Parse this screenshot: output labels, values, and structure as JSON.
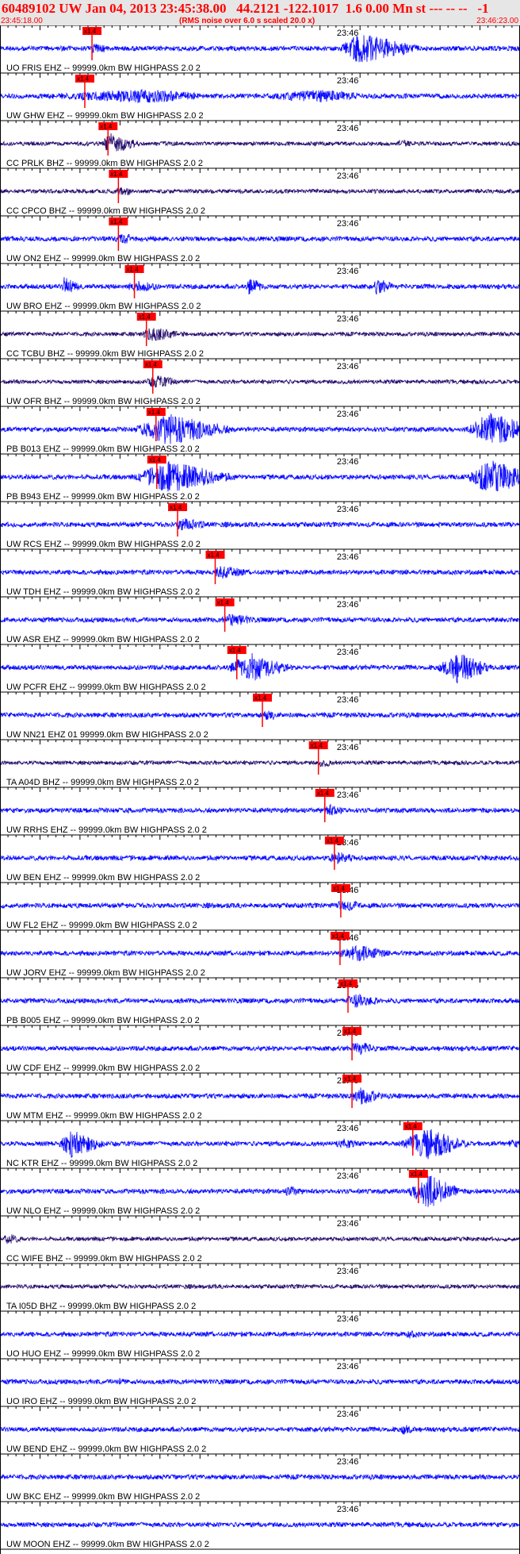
{
  "header": {
    "title": "60489102 UW Jan 04, 2013 23:45:38.00   44.2121 -122.1017  1.6 0.00 Mn st --- -- --   -1",
    "start_time": "23:45:18.00",
    "note": "(RMS noise over 6.0 s scaled 20.0 x)",
    "end_time": "23:46:23.00"
  },
  "colors": {
    "trace_blue": "#0000ff",
    "trace_dark": "#1a0066",
    "pick_red": "#ff0000",
    "header_bg": "#e6e6e6",
    "header_text": "#ff0000"
  },
  "chart_data": {
    "type": "line",
    "title": "60489102 UW Jan 04, 2013 23:45:38.00   44.2121 -122.1017  1.6 0.00 Mn st --- -- --   -1",
    "x_range": [
      "23:45:18.00",
      "23:46:23.00"
    ],
    "minute_mark": "23:46",
    "pick_label": "x1.4",
    "grid": false,
    "traces": [
      {
        "label": "UO FRIS EHZ -- 99999.0km BW  HIGHPASS  2.0  2",
        "color": "blue",
        "pick_s": 11.5,
        "bursts": [
          [
            45,
            3,
            9,
            20
          ],
          [
            7.5,
            1,
            4,
            4
          ]
        ]
      },
      {
        "label": "UW GHW EHZ -- 99999.0km BW  HIGHPASS  2.0  2",
        "color": "blue",
        "pick_s": 10.6,
        "bursts": [
          [
            19,
            20,
            10,
            9
          ],
          [
            40,
            12,
            9,
            8
          ]
        ]
      },
      {
        "label": "CC PRLK BHZ -- 99999.0km BW  HIGHPASS  2.0  2",
        "color": "dark",
        "pick_s": 13.5,
        "bursts": [
          [
            13.6,
            1,
            5,
            14
          ],
          [
            50,
            1,
            4,
            5
          ]
        ]
      },
      {
        "label": "CC CPCO BHZ -- 99999.0km BW  HIGHPASS  2.0  2",
        "color": "dark",
        "pick_s": 14.8,
        "bursts": [
          [
            15,
            2,
            3,
            5
          ]
        ]
      },
      {
        "label": "UW ON2 EHZ -- 99999.0km BW  HIGHPASS  2.0  2",
        "color": "blue",
        "pick_s": 14.8,
        "bursts": [
          [
            15,
            1,
            3,
            5
          ],
          [
            30,
            3,
            3,
            3
          ]
        ]
      },
      {
        "label": "UW BRO EHZ -- 99999.0km BW  HIGHPASS  2.0  2",
        "color": "blue",
        "pick_s": 16.8,
        "bursts": [
          [
            8,
            0.3,
            3,
            12
          ],
          [
            17,
            2,
            5,
            8
          ],
          [
            31,
            0.3,
            3,
            12
          ],
          [
            47,
            0.3,
            3,
            12
          ]
        ]
      },
      {
        "label": "CC TCBU BHZ -- 99999.0km BW  HIGHPASS  2.0  2",
        "color": "dark",
        "pick_s": 18.3,
        "bursts": [
          [
            19,
            2,
            6,
            9
          ]
        ]
      },
      {
        "label": "UW OFR BHZ -- 99999.0km BW  HIGHPASS  2.0  2",
        "color": "dark",
        "pick_s": 19.1,
        "bursts": [
          [
            19.5,
            2,
            4,
            9
          ]
        ]
      },
      {
        "label": "PB B013 EHZ -- 99999.0km BW  HIGHPASS  2.0  2",
        "color": "blue",
        "pick_s": 19.5,
        "bursts": [
          [
            21,
            5,
            10,
            20
          ],
          [
            61,
            3,
            8,
            22
          ]
        ]
      },
      {
        "label": "PB B943 EHZ -- 99999.0km BW  HIGHPASS  2.0  2",
        "color": "blue",
        "pick_s": 19.6,
        "bursts": [
          [
            21,
            5,
            10,
            20
          ],
          [
            61,
            3,
            8,
            22
          ]
        ]
      },
      {
        "label": "UW RCS EHZ -- 99999.0km BW  HIGHPASS  2.0  2",
        "color": "blue",
        "pick_s": 22.2,
        "bursts": [
          [
            22.8,
            1.5,
            5,
            9
          ]
        ]
      },
      {
        "label": "UW TDH EHZ -- 99999.0km BW  HIGHPASS  2.0  2",
        "color": "blue",
        "pick_s": 26.9,
        "bursts": [
          [
            27.6,
            1.5,
            5,
            9
          ]
        ]
      },
      {
        "label": "UW ASR EHZ -- 99999.0km BW  HIGHPASS  2.0  2",
        "color": "blue",
        "pick_s": 28.1,
        "bursts": [
          [
            28.7,
            1.5,
            5,
            9
          ]
        ]
      },
      {
        "label": "UW PCFR EHZ -- 99999.0km BW  HIGHPASS  2.0  2",
        "color": "blue",
        "pick_s": 29.6,
        "bursts": [
          [
            31.5,
            4,
            6,
            18
          ],
          [
            57.2,
            3,
            5,
            20
          ]
        ]
      },
      {
        "label": "UW NN21 EHZ 01 99999.0km BW  HIGHPASS  2.0  2",
        "color": "blue",
        "pick_s": 32.8,
        "bursts": []
      },
      {
        "label": "TA A04D BHZ -- 99999.0km BW  HIGHPASS  2.0  2",
        "color": "dark",
        "pick_s": 39.8,
        "bursts": []
      },
      {
        "label": "UW RRHS EHZ -- 99999.0km BW  HIGHPASS  2.0  2",
        "color": "blue",
        "pick_s": 40.6,
        "bursts": [
          [
            41,
            1,
            4,
            8
          ],
          [
            16,
            1,
            3,
            4
          ]
        ]
      },
      {
        "label": "UW BEN EHZ -- 99999.0km BW  HIGHPASS  2.0  2",
        "color": "blue",
        "pick_s": 41.8,
        "bursts": [
          [
            42,
            1.5,
            4,
            9
          ]
        ]
      },
      {
        "label": "UW FL2 EHZ -- 99999.0km BW  HIGHPASS  2.0  2",
        "color": "blue",
        "pick_s": 42.6,
        "bursts": [
          [
            43,
            2,
            4,
            8
          ]
        ]
      },
      {
        "label": "UW JORV EHZ -- 99999.0km BW  HIGHPASS  2.0  2",
        "color": "blue",
        "pick_s": 42.5,
        "bursts": [
          [
            44.5,
            3,
            6,
            11
          ]
        ]
      },
      {
        "label": "PB B005 EHZ -- 99999.0km BW  HIGHPASS  2.0  2",
        "color": "blue",
        "pick_s": 43.5,
        "bursts": [
          [
            44.5,
            2,
            5,
            9
          ]
        ]
      },
      {
        "label": "UW CDF EHZ -- 99999.0km BW  HIGHPASS  2.0  2",
        "color": "blue",
        "pick_s": 44.0,
        "bursts": [
          [
            44.8,
            1.5,
            4,
            9
          ]
        ]
      },
      {
        "label": "UW MTM EHZ -- 99999.0km BW  HIGHPASS  2.0  2",
        "color": "blue",
        "pick_s": 44.0,
        "bursts": [
          [
            45,
            1.5,
            4,
            12
          ]
        ]
      },
      {
        "label": "NC KTR EHZ -- 99999.0km BW  HIGHPASS  2.0  2",
        "color": "blue",
        "pick_s": 51.6,
        "bursts": [
          [
            9,
            2,
            5,
            18
          ],
          [
            53.5,
            4,
            6,
            20
          ],
          [
            43,
            2,
            3,
            7
          ],
          [
            64,
            1,
            3,
            6
          ]
        ]
      },
      {
        "label": "UW NLO EHZ -- 99999.0km BW  HIGHPASS  2.0  2",
        "color": "blue",
        "pick_s": 52.3,
        "bursts": [
          [
            53.5,
            3,
            5,
            22
          ],
          [
            36,
            0.5,
            3,
            8
          ]
        ]
      },
      {
        "label": "CC WIFE BHZ -- 99999.0km BW  HIGHPASS  2.0  2",
        "color": "dark",
        "pick_s": null,
        "bursts": [
          [
            0.7,
            0.3,
            3,
            8
          ]
        ]
      },
      {
        "label": "TA I05D BHZ -- 99999.0km BW  HIGHPASS  2.0  2",
        "color": "dark",
        "pick_s": null,
        "bursts": []
      },
      {
        "label": "UO HUO EHZ -- 99999.0km BW  HIGHPASS  2.0  2",
        "color": "blue",
        "pick_s": null,
        "bursts": [
          [
            51,
            0.3,
            3,
            6
          ]
        ]
      },
      {
        "label": "UO IRO EHZ -- 99999.0km BW  HIGHPASS  2.0  2",
        "color": "blue",
        "pick_s": null,
        "bursts": [
          [
            15,
            1,
            3,
            5
          ]
        ]
      },
      {
        "label": "UW BEND EHZ -- 99999.0km BW  HIGHPASS  2.0  2",
        "color": "blue",
        "pick_s": null,
        "bursts": [
          [
            50.5,
            1,
            3,
            7
          ]
        ]
      },
      {
        "label": "UW BKC EHZ -- 99999.0km BW  HIGHPASS  2.0  2",
        "color": "blue",
        "pick_s": null,
        "bursts": []
      },
      {
        "label": "UW MOON EHZ -- 99999.0km BW  HIGHPASS  2.0  2",
        "color": "blue",
        "pick_s": null,
        "bursts": []
      }
    ]
  }
}
